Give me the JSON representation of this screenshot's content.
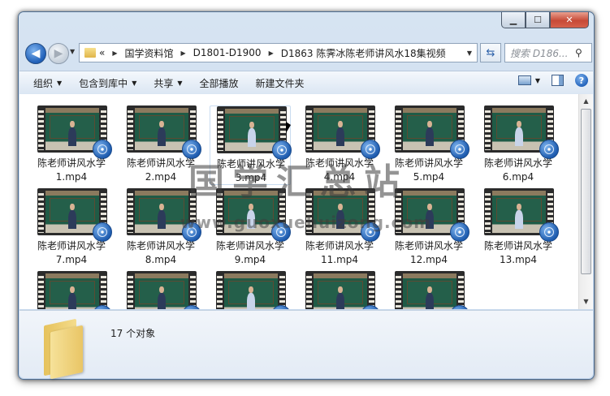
{
  "window": {
    "caption_buttons": [
      "minimize",
      "maximize",
      "close"
    ]
  },
  "nav": {
    "back_icon": "back-arrow-icon",
    "forward_icon": "forward-arrow-icon"
  },
  "address": {
    "prefix": "«",
    "crumbs": [
      "国学资料馆",
      "D1801-D1900",
      "D1863 陈霁冰陈老师讲风水18集视频"
    ]
  },
  "search": {
    "placeholder": "搜索 D186..."
  },
  "toolbar": {
    "organize": "组织",
    "include_library": "包含到库中",
    "share": "共享",
    "play_all": "全部播放",
    "new_folder": "新建文件夹"
  },
  "files": [
    {
      "line1": "陈老师讲风水学",
      "line2": "1.mp4"
    },
    {
      "line1": "陈老师讲风水学",
      "line2": "2.mp4"
    },
    {
      "line1": "陈老师讲风水学",
      "line2": "3.mp4",
      "selected": true
    },
    {
      "line1": "陈老师讲风水学",
      "line2": "4.mp4"
    },
    {
      "line1": "陈老师讲风水学",
      "line2": "5.mp4"
    },
    {
      "line1": "陈老师讲风水学",
      "line2": "6.mp4"
    },
    {
      "line1": "陈老师讲风水学",
      "line2": "7.mp4"
    },
    {
      "line1": "陈老师讲风水学",
      "line2": "8.mp4"
    },
    {
      "line1": "陈老师讲风水学",
      "line2": "9.mp4"
    },
    {
      "line1": "陈老师讲风水学",
      "line2": "11.mp4"
    },
    {
      "line1": "陈老师讲风水学",
      "line2": "12.mp4"
    },
    {
      "line1": "陈老师讲风水学",
      "line2": "13.mp4"
    },
    {
      "line1": "",
      "line2": ""
    },
    {
      "line1": "",
      "line2": ""
    },
    {
      "line1": "",
      "line2": ""
    },
    {
      "line1": "",
      "line2": ""
    },
    {
      "line1": "",
      "line2": ""
    }
  ],
  "details": {
    "count_text": "17 个对象"
  },
  "watermark": {
    "title": "国学汇总站",
    "url": "www.guoxuehuizong.com"
  }
}
